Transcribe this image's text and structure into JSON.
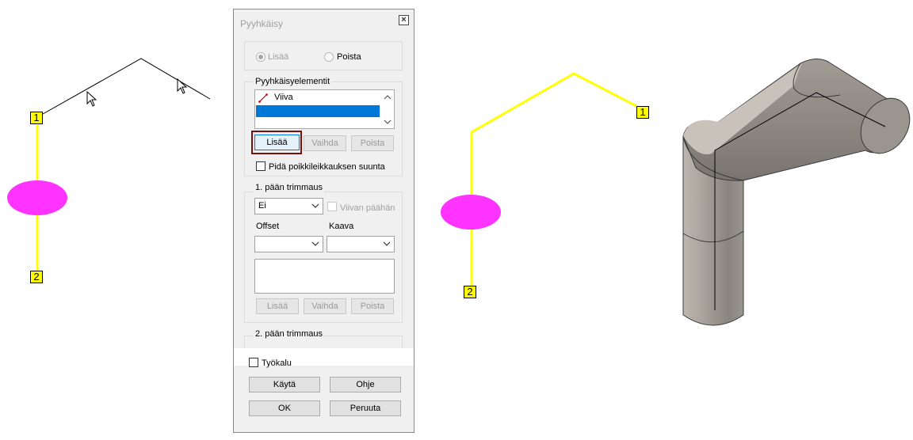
{
  "viewport_left": {
    "point_labels": [
      "1",
      "2"
    ]
  },
  "viewport_right": {
    "point_labels": [
      "1",
      "2"
    ]
  },
  "colors": {
    "path_yellow": "#ffff00",
    "profile_magenta": "#ff33ff",
    "selection_blue": "#0078d7",
    "focus_frame": "#7a0d0d"
  },
  "dialog": {
    "title": "Pyyhkäisy",
    "close_icon": "close-icon",
    "mode": {
      "options": [
        "Lisää",
        "Poista"
      ],
      "selected": "Lisää"
    },
    "sweep_elements": {
      "label": "Pyyhkäisyelementit",
      "items": [
        {
          "icon": "line-icon",
          "text": "Viiva"
        },
        {
          "icon": "",
          "text": ""
        }
      ],
      "buttons": {
        "add": "Lisää",
        "change": "Vaihda",
        "remove": "Poista"
      },
      "keep_direction_label": "Pidä poikkileikkauksen suunta",
      "keep_direction_checked": false
    },
    "trim1": {
      "label": "1. pään trimmaus",
      "mode_value": "Ei",
      "line_end_label": "Viivan päähän",
      "offset_label": "Offset",
      "formula_label": "Kaava",
      "offset_value": "",
      "formula_value": "",
      "buttons": {
        "add": "Lisää",
        "change": "Vaihda",
        "remove": "Poista"
      }
    },
    "trim2": {
      "label": "2. pään trimmaus"
    },
    "tool_label": "Työkalu",
    "tool_checked": false,
    "buttons": {
      "apply": "Käytä",
      "help": "Ohje",
      "ok": "OK",
      "cancel": "Peruuta"
    }
  }
}
